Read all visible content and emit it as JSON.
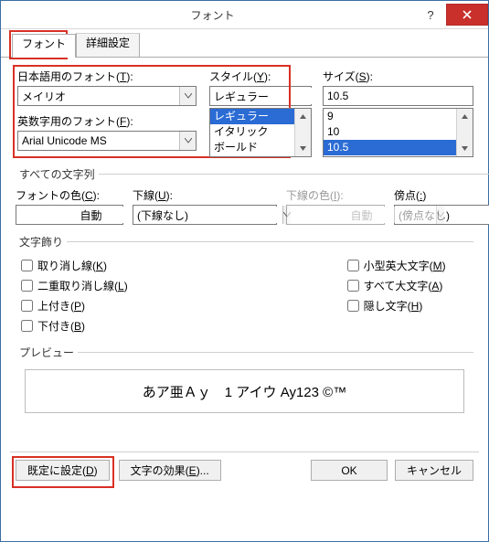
{
  "window": {
    "title": "フォント"
  },
  "tabs": {
    "font": "フォント",
    "advanced": "詳細設定"
  },
  "labels": {
    "jp_font": "日本語用のフォント(",
    "jp_font_k": "T",
    "jp_font_e": "):",
    "ascii_font": "英数字用のフォント(",
    "ascii_font_k": "F",
    "ascii_font_e": "):",
    "style": "スタイル(",
    "style_k": "Y",
    "style_e": "):",
    "size": "サイズ(",
    "size_k": "S",
    "size_e": "):"
  },
  "values": {
    "jp_font": "メイリオ",
    "ascii_font": "Arial Unicode MS",
    "style": "レギュラー",
    "size": "10.5"
  },
  "style_list": {
    "i0": "レギュラー",
    "i1": "イタリック",
    "i2": "ボールド"
  },
  "size_list": {
    "i0": "9",
    "i1": "10",
    "i2": "10.5"
  },
  "all_text": {
    "legend": "すべての文字列",
    "font_color": "フォントの色(",
    "font_color_k": "C",
    "font_color_e": "):",
    "underline": "下線(",
    "underline_k": "U",
    "underline_e": "):",
    "underline_color": "下線の色(",
    "underline_color_k": "I",
    "underline_color_e": "):",
    "emphasis": "傍点(",
    "emphasis_k": ":",
    "emphasis_e": ")",
    "auto": "自動",
    "underline_none": "(下線なし)",
    "emphasis_none": "(傍点なし)"
  },
  "effects": {
    "legend": "文字飾り",
    "strike": "取り消し線(",
    "strike_k": "K",
    "strike_e": ")",
    "dstrike": "二重取り消し線(",
    "dstrike_k": "L",
    "dstrike_e": ")",
    "sup": "上付き(",
    "sup_k": "P",
    "sup_e": ")",
    "sub": "下付き(",
    "sub_k": "B",
    "sub_e": ")",
    "smallcaps": "小型英大文字(",
    "smallcaps_k": "M",
    "smallcaps_e": ")",
    "allcaps": "すべて大文字(",
    "allcaps_k": "A",
    "allcaps_e": ")",
    "hidden": "隠し文字(",
    "hidden_k": "H",
    "hidden_e": ")"
  },
  "preview": {
    "legend": "プレビュー",
    "text": "あア亜Ａｙ　1 アイウ Ay123 ©™"
  },
  "footer": {
    "default_btn": "既定に設定(",
    "default_k": "D",
    "default_e": ")",
    "text_effects": "文字の効果(",
    "text_effects_k": "E",
    "text_effects_e": ")...",
    "ok": "OK",
    "cancel": "キャンセル"
  }
}
